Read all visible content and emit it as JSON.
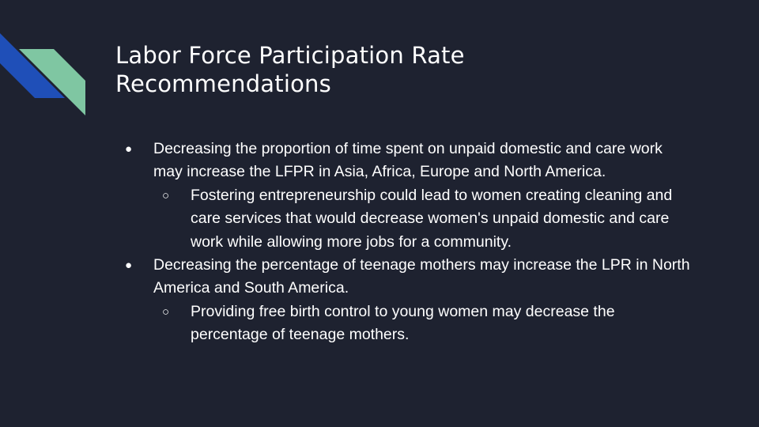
{
  "slide": {
    "title_lines": [
      "Labor Force Participation Rate",
      "Recommendations"
    ],
    "accent_colors": {
      "blue": "#1f4fb8",
      "green": "#7fc6a2",
      "background": "#1e2230"
    },
    "bullets": [
      {
        "marker": "●",
        "text": "Decreasing the proportion of time spent on unpaid domestic and care work may increase the LFPR in Asia, Africa, Europe and North America.",
        "sub": {
          "marker": "○",
          "text": "Fostering entrepreneurship could lead to women creating cleaning and care services that would decrease women's unpaid domestic and care work while allowing more jobs for a community."
        }
      },
      {
        "marker": "●",
        "text": "Decreasing the percentage of teenage mothers may increase the LPR in North America and South America.",
        "sub": {
          "marker": "○",
          "text": "Providing free birth control to young women may decrease the percentage of teenage mothers."
        }
      }
    ]
  }
}
